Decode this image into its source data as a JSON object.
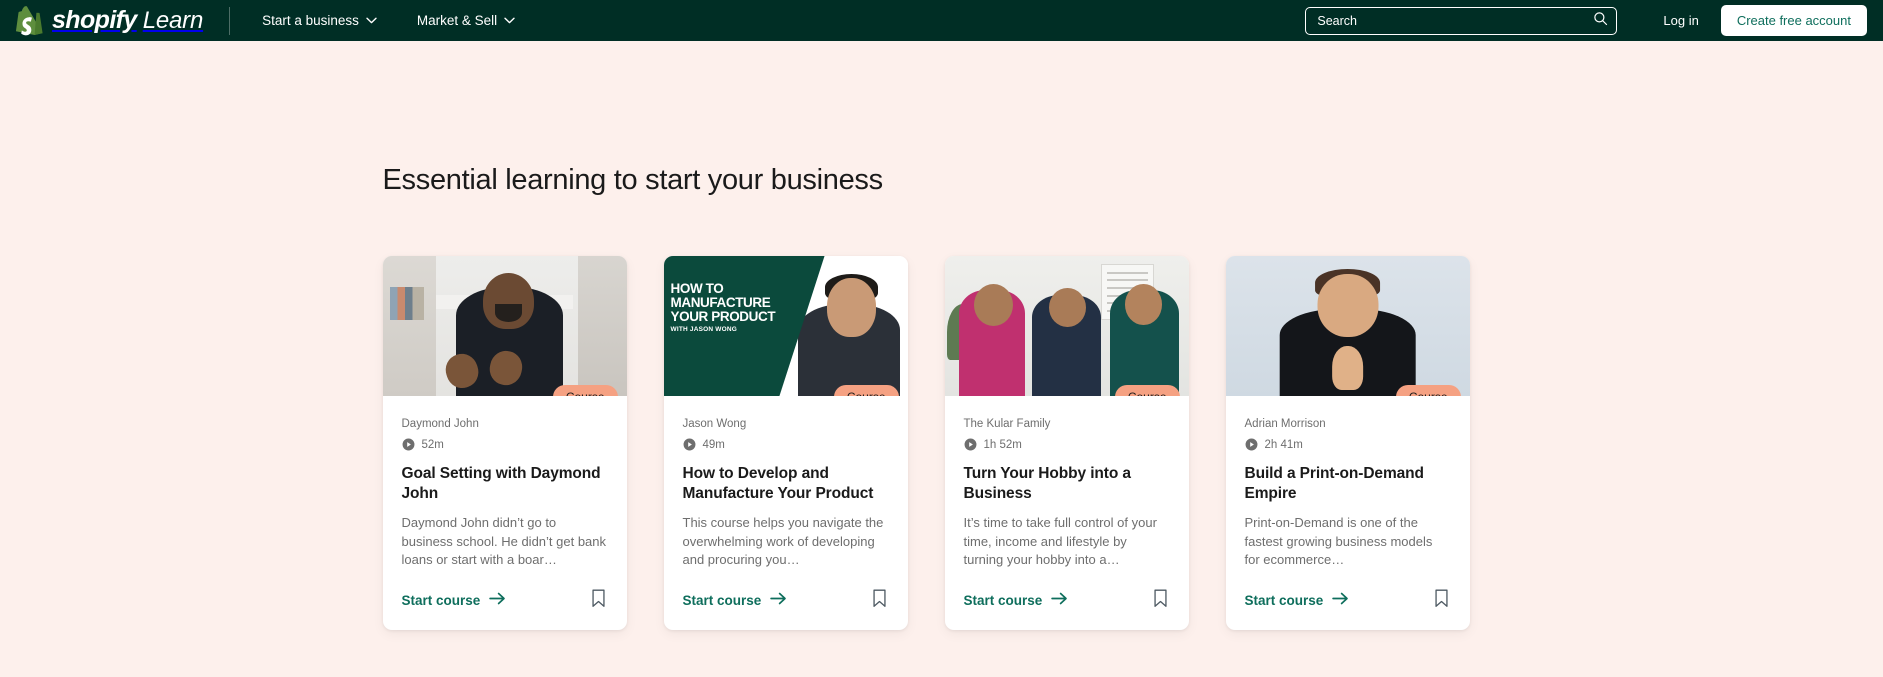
{
  "header": {
    "brand": {
      "shopify": "shopify",
      "learn": "Learn",
      "logo_icon": "shopify-bag-logo"
    },
    "nav": [
      {
        "label": "Start a business",
        "icon": "chevron-down-icon"
      },
      {
        "label": "Market & Sell",
        "icon": "chevron-down-icon"
      }
    ],
    "search": {
      "placeholder": "Search",
      "value": "",
      "icon": "search-icon"
    },
    "login_label": "Log in",
    "cta_label": "Create free account"
  },
  "main": {
    "section_title": "Essential learning to start your business",
    "cards": [
      {
        "author": "Daymond John",
        "duration": "52m",
        "duration_icon": "play-circle-icon",
        "badge": "Course",
        "title": "Goal Setting with Daymond John",
        "description": "Daymond John didn’t go to business school. He didn’t get bank loans or start with a boar…",
        "link_label": "Start course",
        "link_icon": "arrow-right-icon",
        "bookmark_icon": "bookmark-icon",
        "thumbnail": "daymond-john-portrait"
      },
      {
        "author": "Jason Wong",
        "duration": "49m",
        "duration_icon": "play-circle-icon",
        "badge": "Course",
        "title": "How to Develop and Manufacture Your Product",
        "description": "This course helps you navigate the overwhelming work of developing and procuring you…",
        "link_label": "Start course",
        "link_icon": "arrow-right-icon",
        "bookmark_icon": "bookmark-icon",
        "thumbnail": "how-to-manufacture-your-product-title-card",
        "thumbnail_text": {
          "line1": "HOW TO",
          "line2": "MANUFACTURE",
          "line3": "YOUR PRODUCT",
          "line4": "WITH JASON WONG"
        }
      },
      {
        "author": "The Kular Family",
        "duration": "1h 52m",
        "duration_icon": "play-circle-icon",
        "badge": "Course",
        "title": "Turn Your Hobby into a Business",
        "description": "It’s time to take full control of your time, income and lifestyle by turning your hobby into a…",
        "link_label": "Start course",
        "link_icon": "arrow-right-icon",
        "bookmark_icon": "bookmark-icon",
        "thumbnail": "kular-family-portrait"
      },
      {
        "author": "Adrian Morrison",
        "duration": "2h 41m",
        "duration_icon": "play-circle-icon",
        "badge": "Course",
        "title": "Build a Print-on-Demand Empire",
        "description": "Print-on-Demand is one of the fastest growing business models for ecommerce…",
        "link_label": "Start course",
        "link_icon": "arrow-right-icon",
        "bookmark_icon": "bookmark-icon",
        "thumbnail": "adrian-morrison-portrait"
      }
    ]
  },
  "colors": {
    "header_bg": "#002E25",
    "page_bg": "#FDF0EC",
    "badge_bg": "#F5A182",
    "link_green": "#0E6E5C",
    "logo_green": "#5E8E3E",
    "card_bg": "#FFFFFF",
    "muted_text": "#6E6E6E",
    "title_text": "#1A1A1A"
  }
}
